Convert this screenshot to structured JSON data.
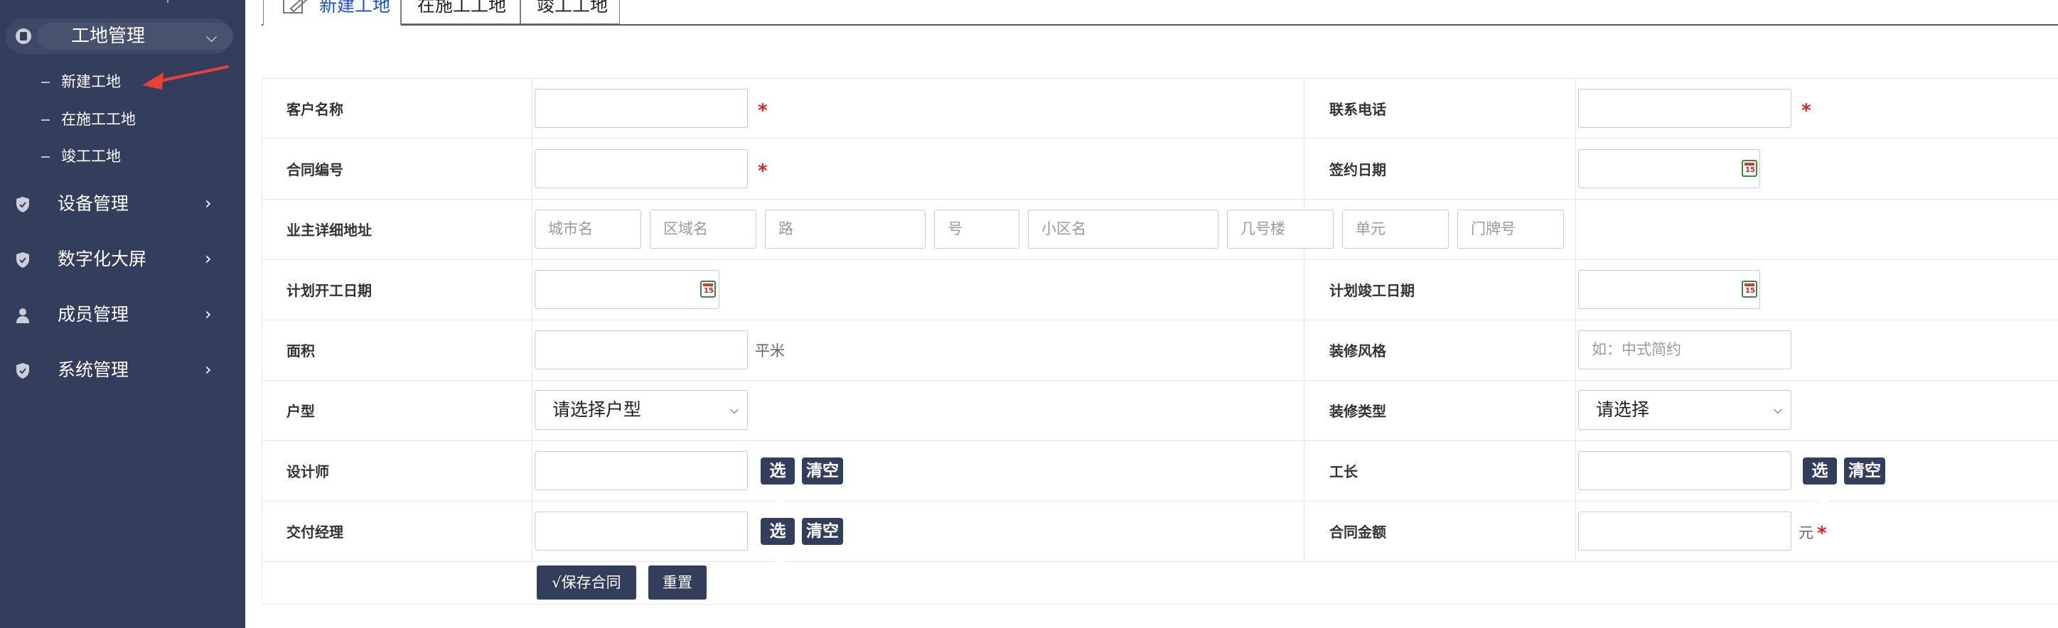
{
  "sidebar": {
    "group": {
      "label": "工地管理",
      "icon": "group-icon",
      "expanded": true
    },
    "sub_items": [
      "新建工地",
      "在施工工地",
      "竣工工地"
    ],
    "items": [
      {
        "label": "设备管理",
        "icon": "shield-icon"
      },
      {
        "label": "数字化大屏",
        "icon": "shield-icon"
      },
      {
        "label": "成员管理",
        "icon": "user-icon"
      },
      {
        "label": "系统管理",
        "icon": "shield-icon"
      }
    ]
  },
  "tabs": [
    {
      "label": "新建工地",
      "active": true,
      "icon": "edit-document-icon"
    },
    {
      "label": "在施工工地",
      "active": false
    },
    {
      "label": "竣工工地",
      "active": false
    }
  ],
  "form": {
    "customer_name": {
      "label": "客户名称",
      "value": "",
      "required": "*"
    },
    "phone": {
      "label": "联系电话",
      "value": "",
      "required": "*"
    },
    "contract_no": {
      "label": "合同编号",
      "value": "",
      "required": "*"
    },
    "sign_date": {
      "label": "签约日期",
      "value": ""
    },
    "address": {
      "label": "业主详细地址",
      "placeholders": [
        "城市名",
        "区域名",
        "路",
        "号",
        "小区名",
        "几号楼",
        "单元",
        "门牌号"
      ]
    },
    "plan_start": {
      "label": "计划开工日期",
      "value": ""
    },
    "plan_end": {
      "label": "计划竣工日期",
      "value": ""
    },
    "area": {
      "label": "面积",
      "value": "",
      "unit": "平米"
    },
    "style": {
      "label": "装修风格",
      "placeholder": "如：中式简约"
    },
    "house_type": {
      "label": "户型",
      "selected": "请选择户型"
    },
    "decor_type": {
      "label": "装修类型",
      "selected": "请选择"
    },
    "designer": {
      "label": "设计师",
      "value": "",
      "select": "选择",
      "clear": "清空"
    },
    "foreman": {
      "label": "工长",
      "value": "",
      "select": "选择",
      "clear": "清空"
    },
    "delivery_manager": {
      "label": "交付经理",
      "value": "",
      "select": "选择",
      "clear": "清空"
    },
    "contract_amount": {
      "label": "合同金额",
      "value": "",
      "unit": "元",
      "required": "*"
    }
  },
  "actions": {
    "save": "√保存合同",
    "reset": "重置"
  },
  "colors": {
    "sidebar_bg": "#333d5c",
    "accent_tab": "#1a4fd1",
    "required": "#e02020",
    "button_bg": "#333d5c",
    "arrow": "#e8413c"
  }
}
